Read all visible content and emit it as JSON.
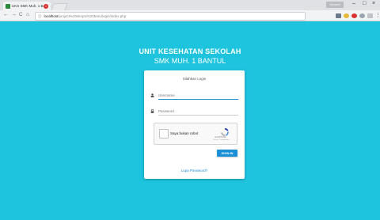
{
  "browser": {
    "tab_title": "UKS SMK Muh. 1 Bantul",
    "tab_close": "×",
    "url_host": "localhost",
    "url_path": "/project%20skripsi%20baru/login/index.php",
    "profile_label": "Geromi",
    "minimize": "–",
    "maximize": "□",
    "close": "×",
    "back": "←",
    "forward": "→",
    "reload": "C",
    "home": "⌂",
    "secure": "ⓘ"
  },
  "header": {
    "line1": "UNIT KESEHATAN SEKOLAH",
    "line2": "SMK MUH. 1 BANTUL"
  },
  "login": {
    "title": "Silahkan Login",
    "username_placeholder": "Username",
    "password_placeholder": "Password",
    "captcha_label": "Saya bukan robot",
    "captcha_brand": "reCAPTCHA",
    "captcha_terms": "Privasi - Persyaratan",
    "signin_label": "SIGN IN",
    "forgot_label": "Lupa Password?"
  },
  "colors": {
    "background": "#1ec3de",
    "accent": "#1a8fd6"
  }
}
